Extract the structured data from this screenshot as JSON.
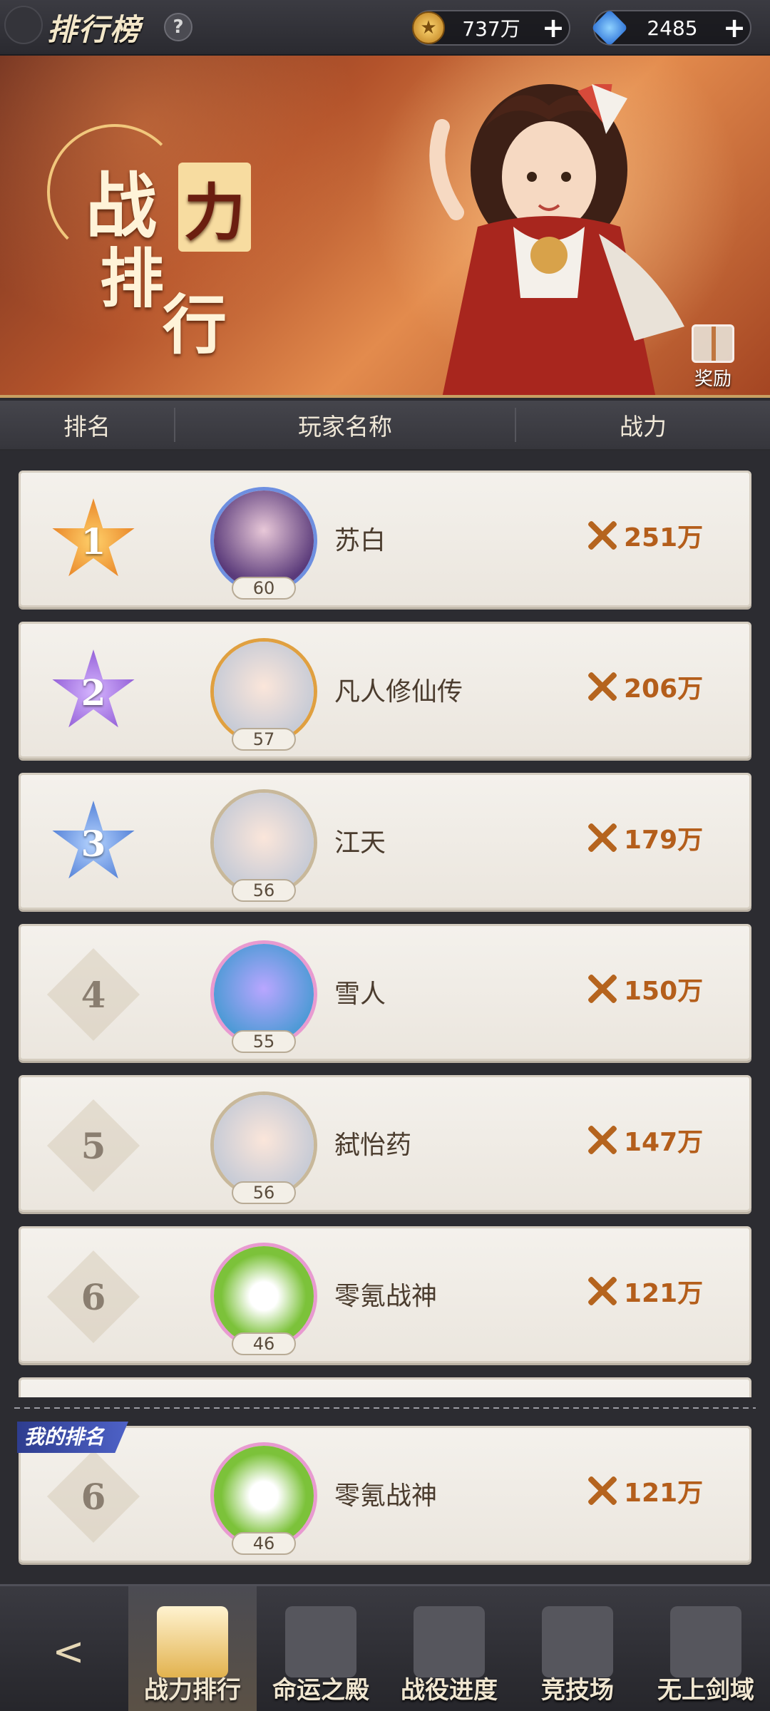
{
  "header": {
    "title": "排行榜",
    "help_label": "?",
    "gold": "737万",
    "gems": "2485",
    "plus": "+"
  },
  "banner": {
    "title_chars": [
      "战",
      "力",
      "排",
      "行"
    ],
    "gift_label": "奖励"
  },
  "columns": {
    "rank": "排名",
    "name": "玩家名称",
    "power": "战力"
  },
  "rows": [
    {
      "rank": "1",
      "name": "苏白",
      "level": "60",
      "power": "251万"
    },
    {
      "rank": "2",
      "name": "凡人修仙传",
      "level": "57",
      "power": "206万"
    },
    {
      "rank": "3",
      "name": "江天",
      "level": "56",
      "power": "179万"
    },
    {
      "rank": "4",
      "name": "雪人",
      "level": "55",
      "power": "150万"
    },
    {
      "rank": "5",
      "name": "弑怡药",
      "level": "56",
      "power": "147万"
    },
    {
      "rank": "6",
      "name": "零氪战神",
      "level": "46",
      "power": "121万"
    }
  ],
  "my_rank": {
    "label": "我的排名",
    "rank": "6",
    "name": "零氪战神",
    "level": "46",
    "power": "121万"
  },
  "nav": {
    "items": [
      {
        "label": "战力排行",
        "active": true
      },
      {
        "label": "命运之殿",
        "active": false
      },
      {
        "label": "战役进度",
        "active": false
      },
      {
        "label": "竞技场",
        "active": false
      },
      {
        "label": "无上剑域",
        "active": false
      }
    ]
  },
  "colors": {
    "rank1": "#f08a24",
    "rank2": "#8e54d6",
    "rank3": "#3f78d6",
    "power_text": "#b45e1b",
    "my_label_bg": "#2e3d8f"
  }
}
